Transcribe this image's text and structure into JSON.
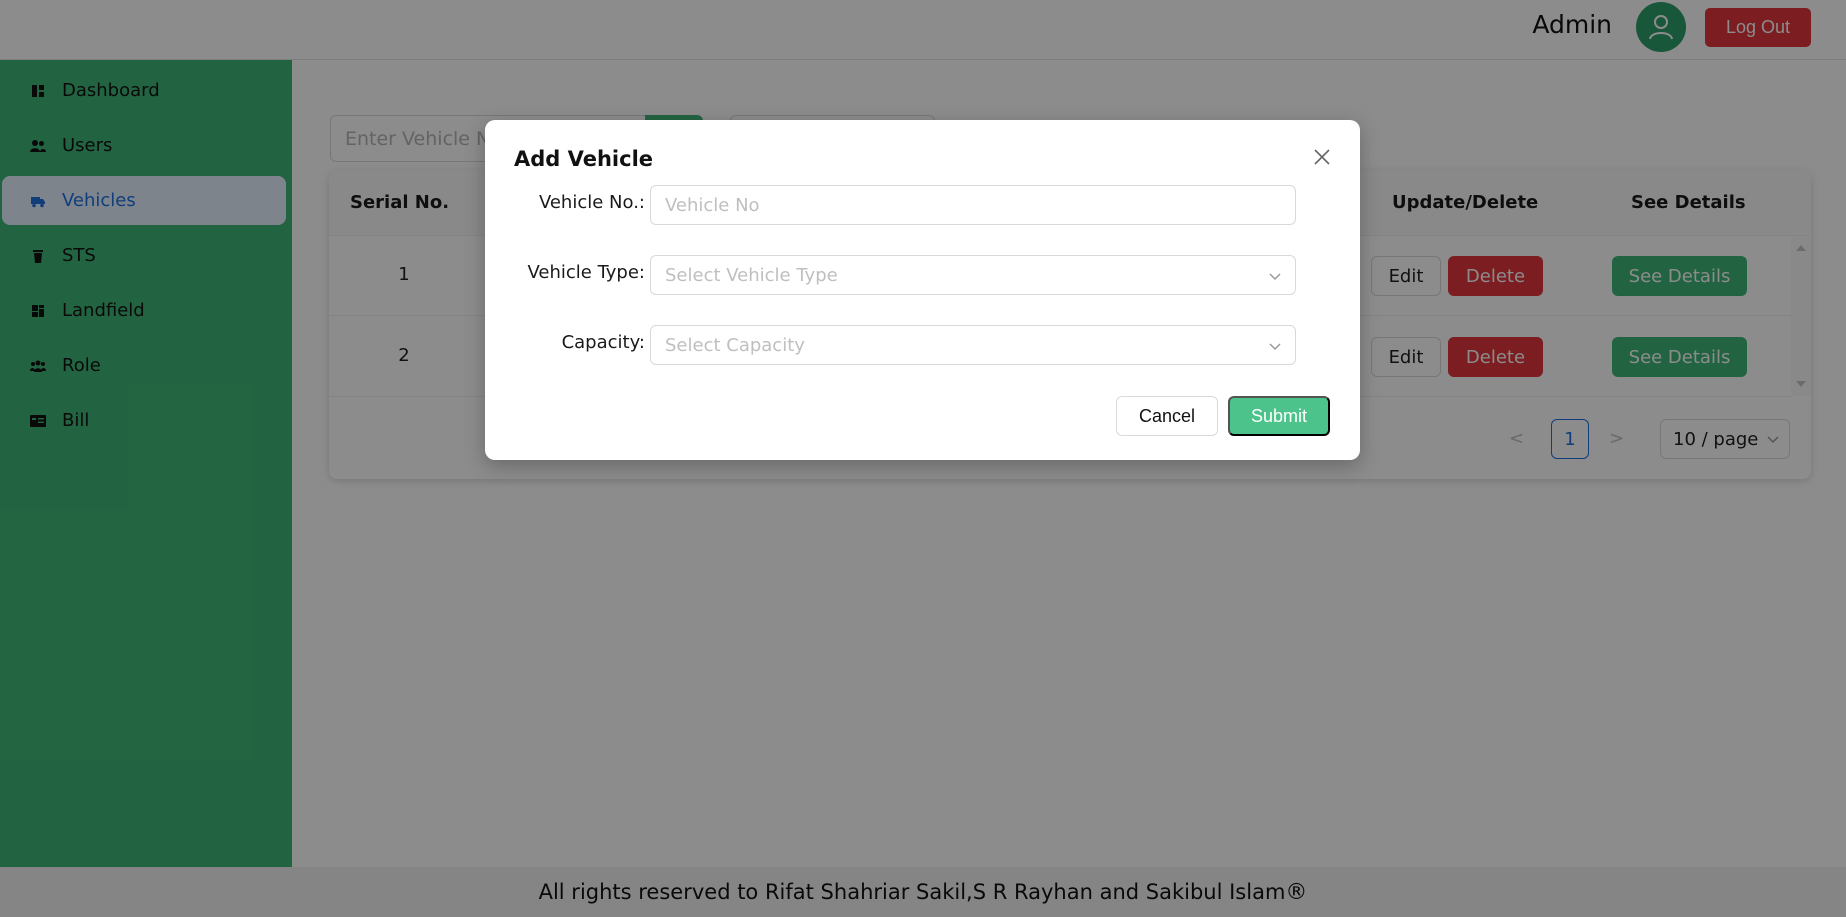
{
  "header": {
    "user_name": "Admin",
    "logout_label": "Log Out",
    "accent_color": "#e0353d",
    "avatar_color": "#2f9e6a"
  },
  "sidebar": {
    "background": "#3fb777",
    "items": [
      {
        "label": "Dashboard",
        "icon": "dashboard-icon",
        "active": false
      },
      {
        "label": "Users",
        "icon": "users-icon",
        "active": false
      },
      {
        "label": "Vehicles",
        "icon": "truck-icon",
        "active": true
      },
      {
        "label": "STS",
        "icon": "bin-icon",
        "active": false
      },
      {
        "label": "Landfield",
        "icon": "landfill-icon",
        "active": false
      },
      {
        "label": "Role",
        "icon": "team-icon",
        "active": false
      },
      {
        "label": "Bill",
        "icon": "bill-icon",
        "active": false
      }
    ]
  },
  "main": {
    "search_placeholder": "Enter Vehicle No",
    "table": {
      "columns": [
        "Serial No.",
        "Update/Delete",
        "See Details"
      ],
      "rows": [
        {
          "serial": "1",
          "edit_label": "Edit",
          "delete_label": "Delete",
          "details_label": "See Details"
        },
        {
          "serial": "2",
          "edit_label": "Edit",
          "delete_label": "Delete",
          "details_label": "See Details"
        }
      ]
    },
    "pagination": {
      "prev": "<",
      "current_page": "1",
      "next": ">",
      "page_size": "10 / page"
    }
  },
  "modal": {
    "title": "Add Vehicle",
    "fields": [
      {
        "label": "Vehicle No.",
        "placeholder": "Vehicle No",
        "type": "text"
      },
      {
        "label": "Vehicle Type",
        "placeholder": "Select Vehicle Type",
        "type": "select"
      },
      {
        "label": "Capacity",
        "placeholder": "Select Capacity",
        "type": "select"
      }
    ],
    "cancel_label": "Cancel",
    "submit_label": "Submit"
  },
  "footer": {
    "text": "All rights reserved to Rifat Shahriar Sakil,S R Rayhan and Sakibul Islam",
    "mark": "®"
  }
}
